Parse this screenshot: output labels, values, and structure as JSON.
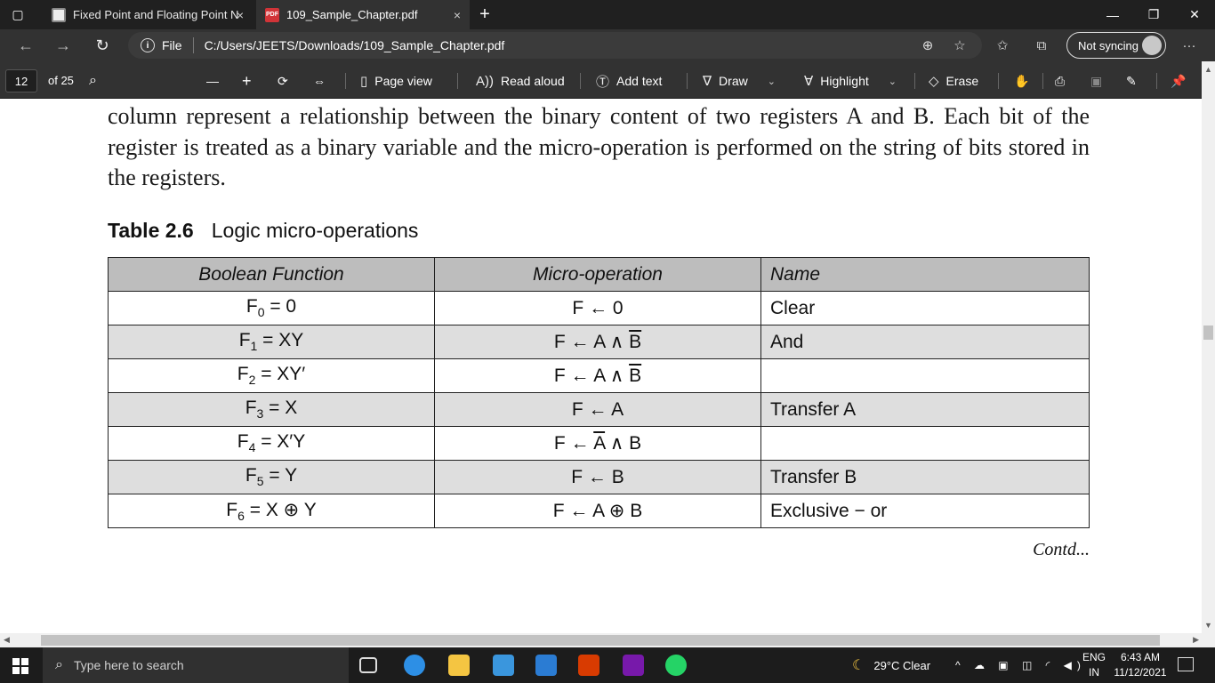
{
  "browser": {
    "tabs": [
      {
        "title": "Fixed Point and Floating Point N",
        "close": "×"
      },
      {
        "title": "109_Sample_Chapter.pdf",
        "close": "×"
      }
    ],
    "new_tab": "+",
    "window_controls": {
      "minimize": "—",
      "restore": "❐",
      "close": "✕"
    },
    "address": {
      "scheme_label": "File",
      "url": "C:/Users/JEETS/Downloads/109_Sample_Chapter.pdf"
    },
    "sync_label": "Not syncing",
    "more": "···"
  },
  "pdf_toolbar": {
    "page_current": "12",
    "page_total": "of 25",
    "zoom_out": "—",
    "zoom_in": "+",
    "page_view": "Page view",
    "read_aloud": "Read aloud",
    "add_text": "Add text",
    "draw": "Draw",
    "highlight": "Highlight",
    "erase": "Erase"
  },
  "document": {
    "paragraph": "column represent a relationship between the binary content of two registers A and B. Each bit of the register is treated as a binary variable and the micro-operation is performed on the string of bits stored in the registers.",
    "table_label": "Table 2.6",
    "table_title": "Logic micro-operations",
    "table": {
      "headers": [
        "Boolean Function",
        "Micro-operation",
        "Name"
      ],
      "rows": [
        {
          "f": "F",
          "sub": "0",
          "expr": " = 0",
          "mo_lhs": "F ← ",
          "mo_pre": "0",
          "mo_bar": "",
          "mo_post": "",
          "name": "Clear"
        },
        {
          "f": "F",
          "sub": "1",
          "expr": " = XY",
          "mo_lhs": "F ← ",
          "mo_pre": "A ∧ ",
          "mo_bar": "B",
          "mo_post": "",
          "name": "And"
        },
        {
          "f": "F",
          "sub": "2",
          "expr": " = XY′",
          "mo_lhs": "F ← ",
          "mo_pre": "A ∧ ",
          "mo_bar": "B",
          "mo_post": "",
          "name": ""
        },
        {
          "f": "F",
          "sub": "3",
          "expr": " = X",
          "mo_lhs": "F ← ",
          "mo_pre": "A",
          "mo_bar": "",
          "mo_post": "",
          "name": "Transfer A"
        },
        {
          "f": "F",
          "sub": "4",
          "expr": " = X′Y",
          "mo_lhs": "F ← ",
          "mo_pre": "",
          "mo_bar": "A",
          "mo_post": " ∧ B",
          "name": ""
        },
        {
          "f": "F",
          "sub": "5",
          "expr": " = Y",
          "mo_lhs": "F ← ",
          "mo_pre": "B",
          "mo_bar": "",
          "mo_post": "",
          "name": "Transfer B"
        },
        {
          "f": "F",
          "sub": "6",
          "expr": " = X ⊕ Y",
          "mo_lhs": "F ← ",
          "mo_pre": "A ⊕ B",
          "mo_bar": "",
          "mo_post": "",
          "name": "Exclusive  −  or"
        }
      ]
    },
    "contd": "Contd..."
  },
  "taskbar": {
    "search_placeholder": "Type here to search",
    "weather": "29°C  Clear",
    "lang_top": "ENG",
    "lang_bottom": "IN",
    "time": "6:43 AM",
    "date": "11/12/2021"
  },
  "colors": {
    "tab_bg": "#202020",
    "toolbar_bg": "#323232",
    "table_header": "#bdbdbd",
    "row_shade": "#dedede",
    "edge_blue": "#2d8fe5"
  }
}
